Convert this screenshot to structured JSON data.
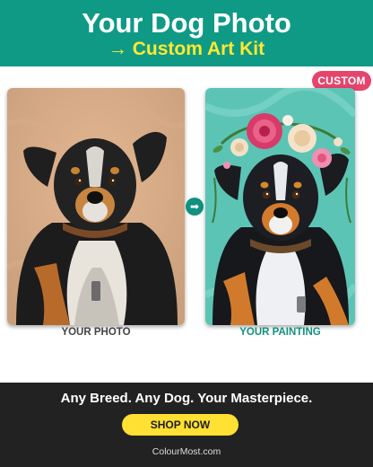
{
  "header": {
    "title": "Your Dog Photo",
    "subtitle": "→ Custom Art Kit"
  },
  "badge": "CUSTOM",
  "left_panel": {
    "caption": "YOUR PHOTO",
    "image": "dog-photo"
  },
  "right_panel": {
    "caption": "YOUR PAINTING",
    "image": "dog-painting-flower-crown"
  },
  "arrow": "arrow-right-icon",
  "footer": {
    "tagline": "Any Breed. Any Dog. Your Masterpiece.",
    "cta": "SHOP NOW",
    "site": "ColourMost.com"
  },
  "colors": {
    "header_bg": "#0f9a86",
    "subtitle": "#ffe930",
    "badge_bg": "#e6446c",
    "cta_bg": "#ffe033",
    "footer_bg": "#222222"
  }
}
